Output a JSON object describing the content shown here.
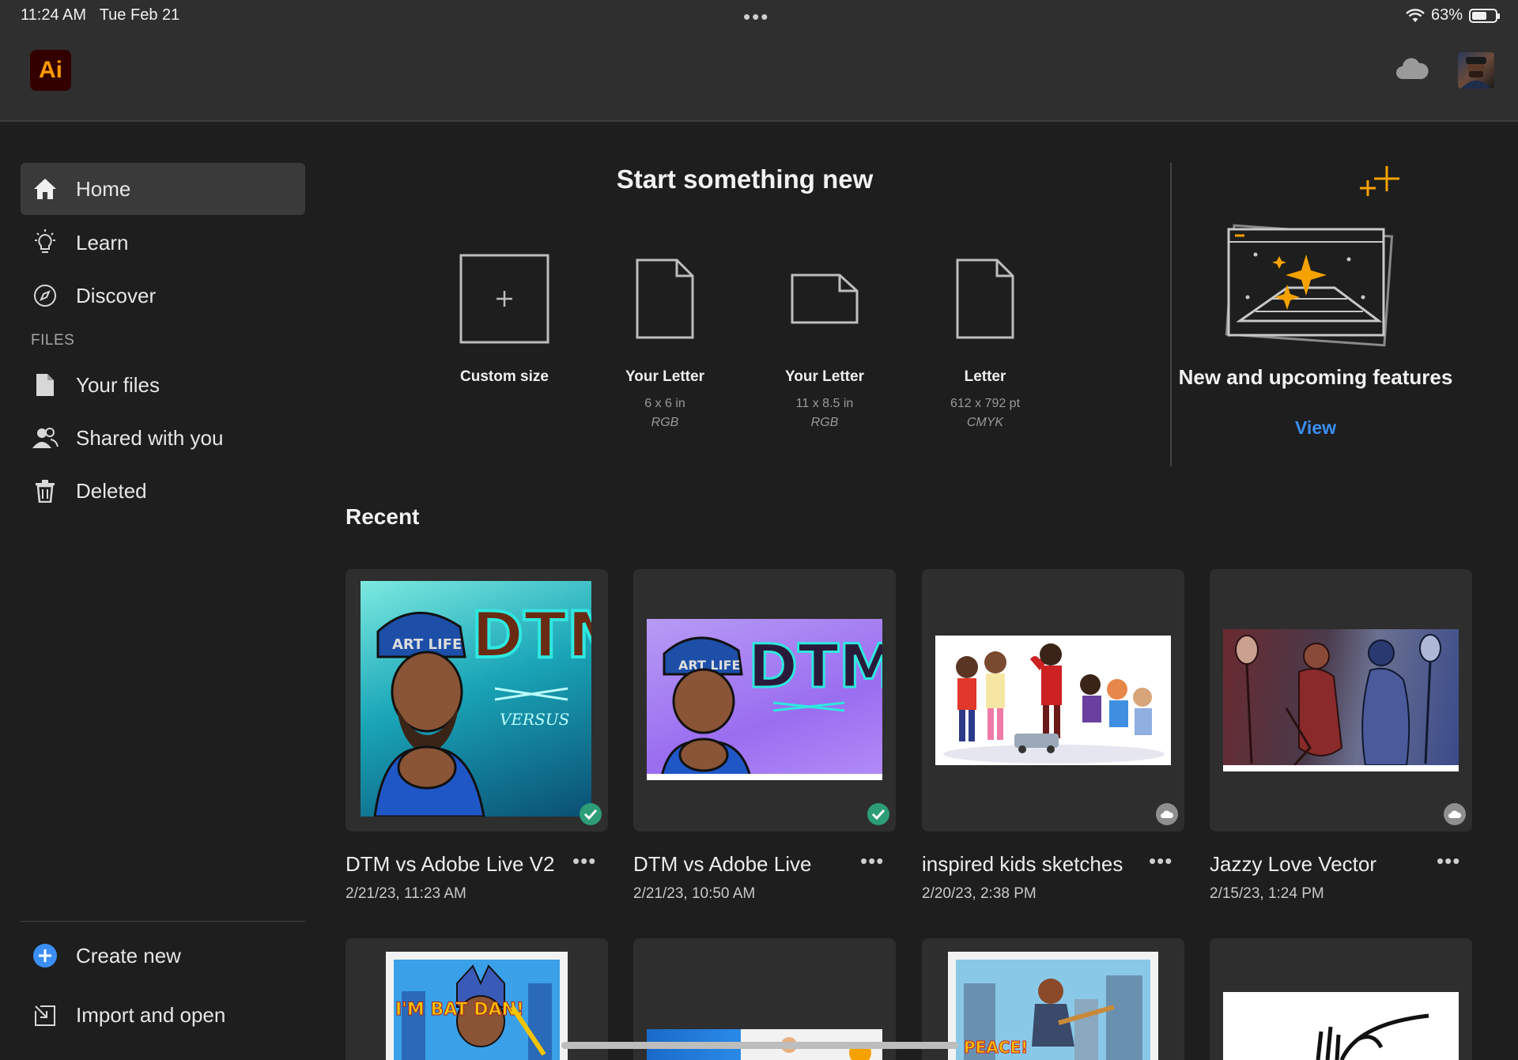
{
  "status_bar": {
    "time": "11:24 AM",
    "date": "Tue Feb 21",
    "battery": "63%",
    "battery_level": 0.63
  },
  "app": {
    "logo_text": "Ai",
    "brand_color": "#ff9a00",
    "logo_bg": "#330000",
    "accent": "#3b8ff5"
  },
  "sidebar": {
    "items": [
      {
        "label": "Home",
        "icon": "home-icon",
        "active": true
      },
      {
        "label": "Learn",
        "icon": "lightbulb-icon"
      },
      {
        "label": "Discover",
        "icon": "compass-icon"
      }
    ],
    "files_heading": "FILES",
    "files": [
      {
        "label": "Your files",
        "icon": "file-icon"
      },
      {
        "label": "Shared with you",
        "icon": "people-icon"
      },
      {
        "label": "Deleted",
        "icon": "trash-icon"
      }
    ],
    "bottom": [
      {
        "label": "Create new",
        "icon": "plus-circle-icon"
      },
      {
        "label": "Import and open",
        "icon": "import-icon"
      }
    ]
  },
  "start": {
    "title": "Start something new",
    "presets": [
      {
        "name": "Custom size",
        "dim": "",
        "mode": ""
      },
      {
        "name": "Your Letter",
        "dim": "6 x 6 in",
        "mode": "RGB"
      },
      {
        "name": "Your Letter",
        "dim": "11 x 8.5 in",
        "mode": "RGB"
      },
      {
        "name": "Letter",
        "dim": "612 x 792 pt",
        "mode": "CMYK"
      }
    ]
  },
  "features": {
    "title": "New and upcoming features",
    "link": "View"
  },
  "recent": {
    "title": "Recent",
    "items": [
      {
        "title": "DTM vs Adobe Live V2",
        "date": "2/21/23, 11:23 AM",
        "status": "synced",
        "more": "•••"
      },
      {
        "title": "DTM vs Adobe Live",
        "date": "2/21/23, 10:50 AM",
        "status": "synced",
        "more": "•••"
      },
      {
        "title": "inspired kids sketches",
        "date": "2/20/23, 2:38 PM",
        "status": "cloud",
        "more": "•••"
      },
      {
        "title": "Jazzy Love Vector",
        "date": "2/15/23, 1:24 PM",
        "status": "cloud",
        "more": "•••"
      }
    ]
  },
  "artwork_text": {
    "card1_logo": "DTM",
    "card1_sub": "VERSUS",
    "card1_cap": "ART LIFE",
    "card2_logo": "DTM",
    "card2_cap": "ART LIFE",
    "card5_text": "I'M BAT DAN!",
    "card7_text": "PEACE!"
  }
}
